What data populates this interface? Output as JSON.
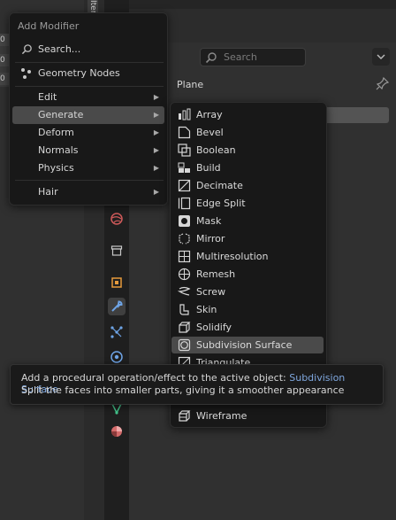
{
  "left_panel": {
    "values": [
      "0",
      "0",
      "0"
    ]
  },
  "vertical_tab_label": "Item",
  "properties": {
    "search_placeholder": "Search",
    "object_name": "Plane"
  },
  "menu": {
    "title": "Add Modifier",
    "search": "Search...",
    "geometry_nodes": "Geometry Nodes",
    "items": [
      {
        "label": "Edit"
      },
      {
        "label": "Generate"
      },
      {
        "label": "Deform"
      },
      {
        "label": "Normals"
      },
      {
        "label": "Physics"
      },
      {
        "label": "Hair"
      }
    ]
  },
  "submenu": {
    "items": [
      {
        "label": "Array",
        "icon": "array-icon"
      },
      {
        "label": "Bevel",
        "icon": "bevel-icon"
      },
      {
        "label": "Boolean",
        "icon": "boolean-icon"
      },
      {
        "label": "Build",
        "icon": "build-icon"
      },
      {
        "label": "Decimate",
        "icon": "decimate-icon"
      },
      {
        "label": "Edge Split",
        "icon": "edge-split-icon"
      },
      {
        "label": "Mask",
        "icon": "mask-icon"
      },
      {
        "label": "Mirror",
        "icon": "mirror-icon"
      },
      {
        "label": "Multiresolution",
        "icon": "multiresolution-icon"
      },
      {
        "label": "Remesh",
        "icon": "remesh-icon"
      },
      {
        "label": "Screw",
        "icon": "screw-icon"
      },
      {
        "label": "Skin",
        "icon": "skin-icon"
      },
      {
        "label": "Solidify",
        "icon": "solidify-icon"
      },
      {
        "label": "Subdivision Surface",
        "icon": "subdivision-surface-icon"
      },
      {
        "label": "Triangulate",
        "icon": "triangulate-icon"
      },
      {
        "label": "Wireframe",
        "icon": "wireframe-icon"
      }
    ]
  },
  "tooltip": {
    "prefix": "Add a procedural operation/effect to the active object: ",
    "highlight": "Subdivision Surface",
    "description": "Split the faces into smaller parts, giving it a smoother appearance"
  },
  "colors": {
    "highlight_row": "#4a4a4a",
    "tooltip_link": "#7fa7de",
    "menu_bg": "#181818"
  }
}
